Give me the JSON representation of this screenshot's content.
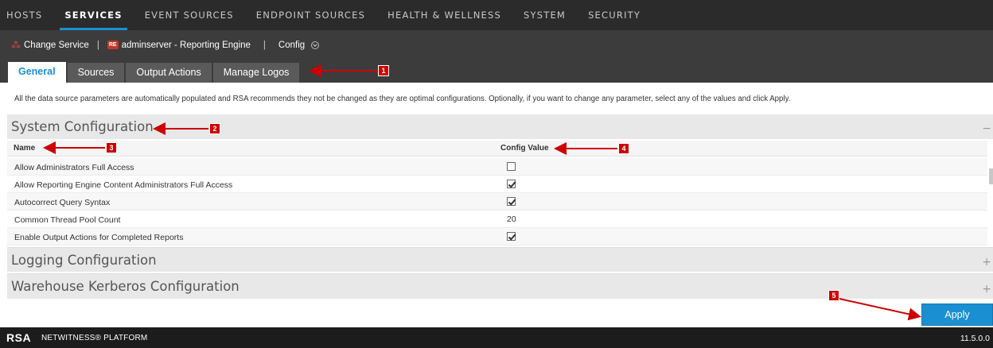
{
  "top_nav": {
    "items": [
      "HOSTS",
      "SERVICES",
      "EVENT SOURCES",
      "ENDPOINT SOURCES",
      "HEALTH & WELLNESS",
      "SYSTEM",
      "SECURITY"
    ],
    "active": "SERVICES"
  },
  "service_bar": {
    "change_service": "Change Service",
    "separator": "|",
    "service_badge": "RE",
    "service_name": "adminserver - Reporting Engine",
    "view": "Config"
  },
  "tabs": [
    "General",
    "Sources",
    "Output Actions",
    "Manage Logos"
  ],
  "active_tab": "General",
  "info_text": "All the data source parameters are automatically populated and RSA recommends they not be changed as they are optimal configurations. Optionally, if you want to change any parameter, select any of the values and click Apply.",
  "sections": {
    "system": {
      "title": "System Configuration",
      "toggle": "−"
    },
    "logging": {
      "title": "Logging Configuration",
      "toggle": "+"
    },
    "kerberos": {
      "title": "Warehouse Kerberos Configuration",
      "toggle": "+"
    }
  },
  "table": {
    "columns": {
      "name": "Name",
      "value": "Config Value"
    },
    "rows": [
      {
        "name": "Allow Administrators Full Access",
        "type": "checkbox",
        "checked": false
      },
      {
        "name": "Allow Reporting Engine Content Administrators Full Access",
        "type": "checkbox",
        "checked": true
      },
      {
        "name": "Autocorrect Query Syntax",
        "type": "checkbox",
        "checked": true
      },
      {
        "name": "Common Thread Pool Count",
        "type": "text",
        "value": "20"
      },
      {
        "name": "Enable Output Actions for Completed Reports",
        "type": "checkbox",
        "checked": true
      }
    ]
  },
  "apply_label": "Apply",
  "footer": {
    "logo": "RSA",
    "brand": "NETWITNESS® PLATFORM",
    "version": "11.5.0.0"
  },
  "callouts": [
    "1",
    "2",
    "3",
    "4",
    "5"
  ],
  "colors": {
    "accent": "#1a8fd1",
    "callout": "#cc0000",
    "nav_bg": "#2b2b2b",
    "bar_bg": "#3c3c3c"
  }
}
